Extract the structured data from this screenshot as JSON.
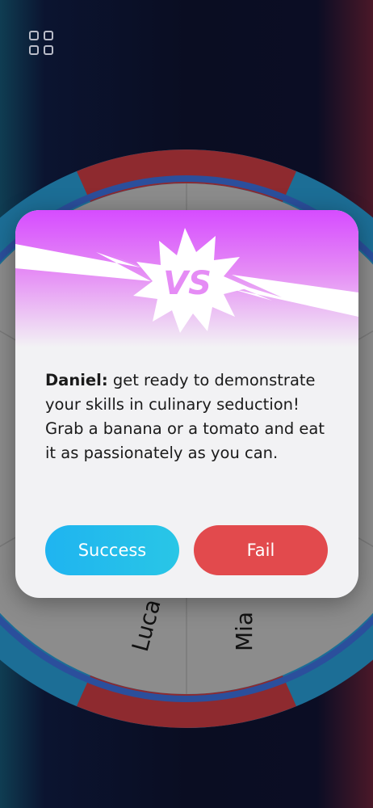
{
  "wheel": {
    "players": [
      {
        "id": "p1",
        "name": "Luca"
      },
      {
        "id": "p2",
        "name": "Mia"
      }
    ],
    "colors": {
      "ring_blue": "#1c6e96",
      "ring_red": "#8e2a2f",
      "inner": "#8c8c8c",
      "rim": "#2b4f9c"
    }
  },
  "modal": {
    "badge": "VS",
    "player": "Daniel:",
    "message": " get ready to demonstrate your skills in culinary seduction! Grab a banana or a tomato and eat it as passionately as you can.",
    "success_label": "Success",
    "fail_label": "Fail",
    "colors": {
      "success": "#1fb4f0",
      "fail": "#e24a4d",
      "header": "#d64cff"
    }
  }
}
